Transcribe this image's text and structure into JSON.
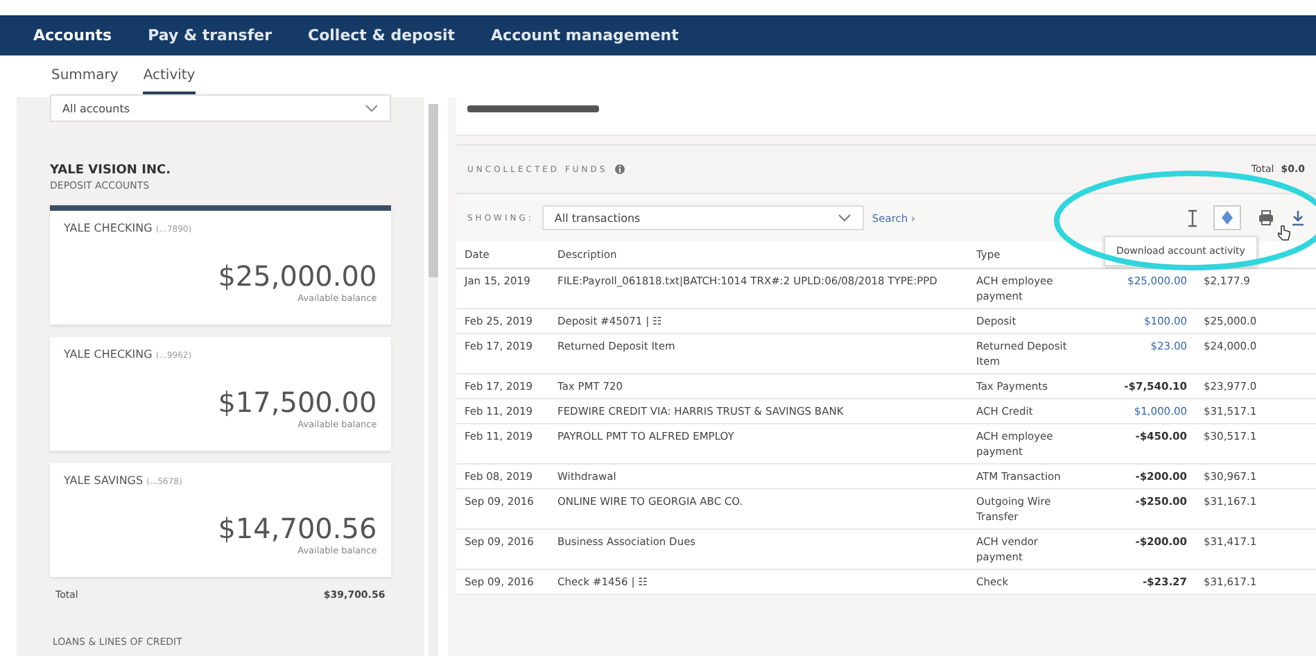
{
  "nav": {
    "items": [
      {
        "label": "Accounts",
        "selected": true
      },
      {
        "label": "Pay & transfer",
        "selected": false
      },
      {
        "label": "Collect & deposit",
        "selected": false
      },
      {
        "label": "Account management",
        "selected": false
      }
    ]
  },
  "subtabs": [
    {
      "label": "Summary",
      "selected": false
    },
    {
      "label": "Activity",
      "selected": true
    }
  ],
  "sidebar": {
    "account_select": {
      "value": "All accounts"
    },
    "company": "YALE VISION INC.",
    "group": "DEPOSIT ACCOUNTS",
    "accounts": [
      {
        "name": "YALE CHECKING",
        "number": "(...7890)",
        "balance": "$25,000.00",
        "balance_label": "Available balance",
        "selected": true
      },
      {
        "name": "YALE CHECKING",
        "number": "(...9962)",
        "balance": "$17,500.00",
        "balance_label": "Available balance",
        "selected": false
      },
      {
        "name": "YALE SAVINGS",
        "number": "(...5678)",
        "balance": "$14,700.56",
        "balance_label": "Available balance",
        "selected": false
      }
    ],
    "total_label": "Total",
    "total_value": "$39,700.56",
    "next_group": "LOANS & LINES OF CREDIT"
  },
  "uncollected": {
    "label": "UNCOLLECTED FUNDS",
    "total_label": "Total",
    "total_value": "$0.0"
  },
  "filter": {
    "label": "SHOWING:",
    "value": "All transactions",
    "search_link": "Search ›"
  },
  "tooltip": "Download account activity",
  "table": {
    "columns": [
      "Date",
      "Description",
      "Type"
    ],
    "rows": [
      {
        "date": "Jan 15, 2019",
        "description": "FILE:Payroll_061818.txt|BATCH:1014 TRX#:2 UPLD:06/08/2018 TYPE:PPD",
        "type": "ACH employee payment",
        "amount": "$25,000.00",
        "kind": "credit",
        "balance": "$2,177.9"
      },
      {
        "date": "Feb 25, 2019",
        "description": "Deposit #45071 | ☷",
        "type": "Deposit",
        "amount": "$100.00",
        "kind": "credit",
        "balance": "$25,000.0"
      },
      {
        "date": "Feb 17, 2019",
        "description": "Returned Deposit Item",
        "type": "Returned Deposit Item",
        "amount": "$23.00",
        "kind": "credit",
        "balance": "$24,000.0"
      },
      {
        "date": "Feb 17, 2019",
        "description": "Tax PMT 720",
        "type": "Tax Payments",
        "amount": "-$7,540.10",
        "kind": "debit",
        "balance": "$23,977.0"
      },
      {
        "date": "Feb 11, 2019",
        "description": "FEDWIRE CREDIT VIA: HARRIS TRUST & SAVINGS BANK",
        "type": "ACH Credit",
        "amount": "$1,000.00",
        "kind": "credit",
        "balance": "$31,517.1"
      },
      {
        "date": "Feb 11, 2019",
        "description": "PAYROLL PMT TO ALFRED EMPLOY",
        "type": "ACH employee payment",
        "amount": "-$450.00",
        "kind": "debit",
        "balance": "$30,517.1"
      },
      {
        "date": "Feb 08, 2019",
        "description": "Withdrawal",
        "type": "ATM Transaction",
        "amount": "-$200.00",
        "kind": "debit",
        "balance": "$30,967.1"
      },
      {
        "date": "Sep 09, 2016",
        "description": "ONLINE WIRE TO GEORGIA ABC CO.",
        "type": "Outgoing Wire Transfer",
        "amount": "-$250.00",
        "kind": "debit",
        "balance": "$31,167.1"
      },
      {
        "date": "Sep 09, 2016",
        "description": "Business Association Dues",
        "type": "ACH vendor payment",
        "amount": "-$200.00",
        "kind": "debit",
        "balance": "$31,417.1"
      },
      {
        "date": "Sep 09, 2016",
        "description": "Check #1456 | ☷",
        "type": "Check",
        "amount": "-$23.27",
        "kind": "debit",
        "balance": "$31,617.1"
      }
    ]
  }
}
